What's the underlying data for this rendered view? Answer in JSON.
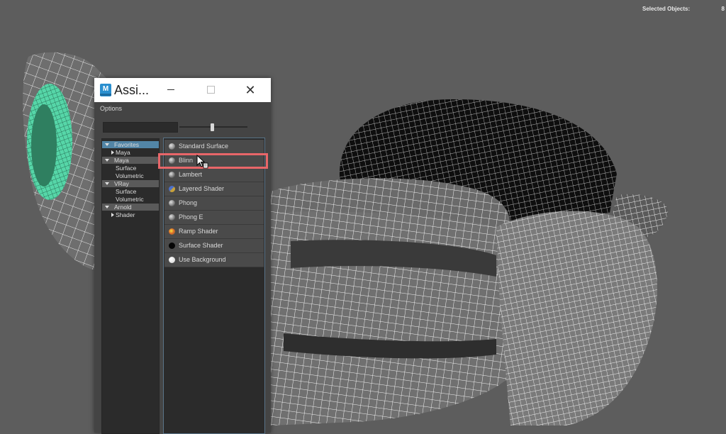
{
  "hud": {
    "selected_label": "Selected Objects:",
    "selected_count": "8"
  },
  "window": {
    "title": "Assi...",
    "app_icon_letter": "M",
    "close_glyph": "✕"
  },
  "options_label": "Options",
  "search": {
    "value": ""
  },
  "tree": [
    {
      "label": "Favorites",
      "type": "category",
      "selected": true
    },
    {
      "label": "Maya",
      "type": "expander"
    },
    {
      "label": "Maya",
      "type": "category"
    },
    {
      "label": "Surface",
      "type": "item"
    },
    {
      "label": "Volumetric",
      "type": "item"
    },
    {
      "label": "VRay",
      "type": "category"
    },
    {
      "label": "Surface",
      "type": "item"
    },
    {
      "label": "Volumetric",
      "type": "item"
    },
    {
      "label": "Arnold",
      "type": "category"
    },
    {
      "label": "Shader",
      "type": "expander"
    }
  ],
  "shaders": [
    {
      "label": "Standard Surface",
      "icon": "gray-sphere-icon",
      "color": "#8a8a8a"
    },
    {
      "label": "Blinn",
      "icon": "gray-sphere-icon",
      "color": "#7a7a7a"
    },
    {
      "label": "Lambert",
      "icon": "gray-sphere-icon",
      "color": "#707070"
    },
    {
      "label": "Layered Shader",
      "icon": "layered-sphere-icon",
      "color": "#c9a23a"
    },
    {
      "label": "Phong",
      "icon": "gray-sphere-icon",
      "color": "#7a7a7a"
    },
    {
      "label": "Phong E",
      "icon": "gray-sphere-icon",
      "color": "#7a7a7a"
    },
    {
      "label": "Ramp Shader",
      "icon": "ramp-sphere-icon",
      "color": "#d45a2a"
    },
    {
      "label": "Surface Shader",
      "icon": "black-sphere-icon",
      "color": "#050505"
    },
    {
      "label": "Use Background",
      "icon": "white-sphere-icon",
      "color": "#d0d0d0"
    }
  ],
  "colors": {
    "highlight": "#e86669",
    "selection": "#5285a6",
    "mesh_accent": "#56d6a8"
  }
}
